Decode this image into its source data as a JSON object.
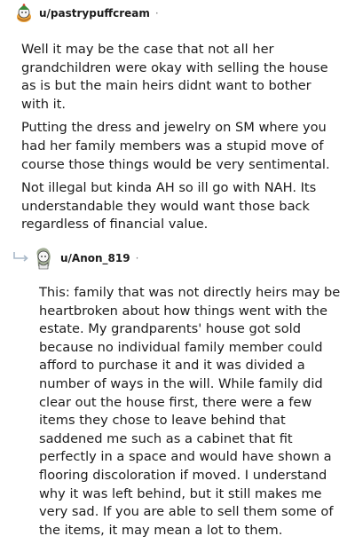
{
  "comments": [
    {
      "username": "u/pastrypuffcream",
      "separator": "·",
      "avatar_icon": "snoo-avatar-icon",
      "paragraphs": [
        "Well it may be the case that not all her grandchildren were okay with selling the house as is but the main heirs didnt want to bother with it.",
        "Putting the dress and jewelry on SM where you had her family members was a stupid move of course those things would be very sentimental.",
        "Not illegal but kinda AH so ill go with NAH. Its understandable they would want those back regardless of financial value."
      ]
    },
    {
      "username": "u/Anon_819",
      "separator": "·",
      "avatar_icon": "snoo-avatar-icon",
      "reply_icon": "reply-arrow-icon",
      "paragraphs": [
        "This: family that was not directly heirs may be heartbroken about how things went with the estate. My grandparents' house got sold because no individual family member could afford to purchase it and it was divided a number of ways in the will. While family did clear out the house first, there were a few items they chose to leave behind that saddened me such as a cabinet that fit perfectly in a space and would have shown a flooring discoloration if moved. I understand why it was left behind, but it still makes me very sad. If you are able to sell them some of the items, it may mean a lot to them."
      ]
    }
  ],
  "colors": {
    "text": "#1c1c1c",
    "muted": "#7c7c7c",
    "avatar_green": "#3c8a3a",
    "avatar_orange": "#e8a13a"
  }
}
